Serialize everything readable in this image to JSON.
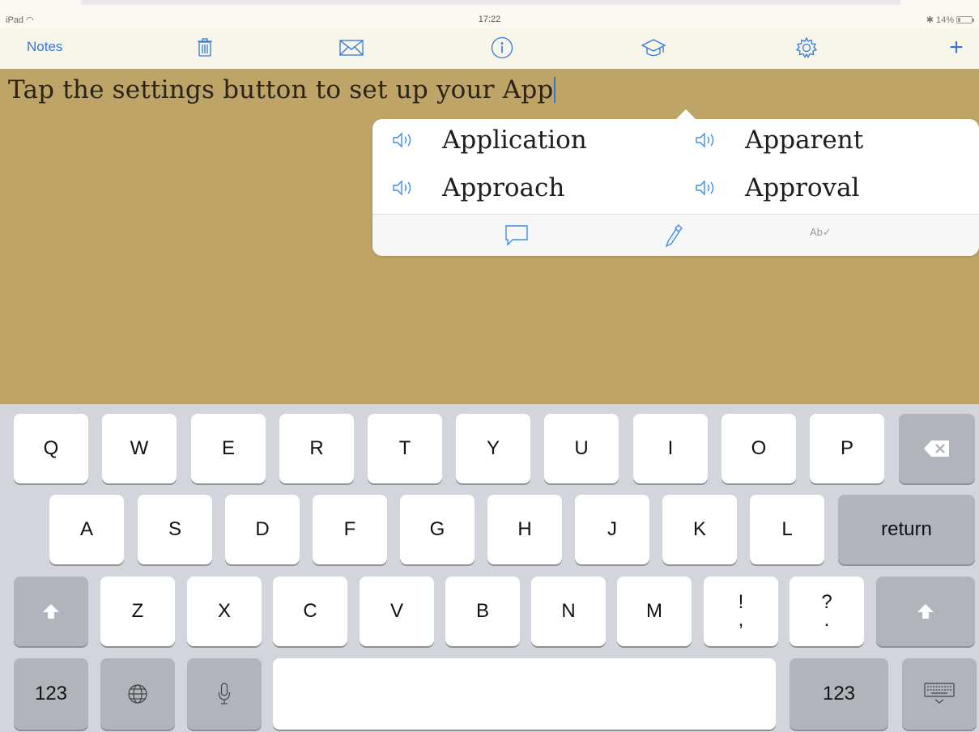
{
  "status_bar": {
    "device": "iPad",
    "time": "17:22",
    "battery": "14%"
  },
  "toolbar": {
    "notes_label": "Notes",
    "plus_label": "+",
    "accent_color": "#2f78d6"
  },
  "editor": {
    "text": "Tap the settings button to set up your App",
    "background": "#bfa467"
  },
  "suggestions": {
    "items": [
      {
        "word": "Application"
      },
      {
        "word": "Apparent"
      },
      {
        "word": "Approach"
      },
      {
        "word": "Approval"
      }
    ],
    "footer_abc_label": "Ab"
  },
  "keyboard": {
    "row1": [
      "Q",
      "W",
      "E",
      "R",
      "T",
      "Y",
      "U",
      "I",
      "O",
      "P"
    ],
    "row2": [
      "A",
      "S",
      "D",
      "F",
      "G",
      "H",
      "J",
      "K",
      "L"
    ],
    "row3": [
      "Z",
      "X",
      "C",
      "V",
      "B",
      "N",
      "M"
    ],
    "punct1_top": "!",
    "punct1_bottom": ",",
    "punct2_top": "?",
    "punct2_bottom": ".",
    "return_label": "return",
    "numbers_label": "123"
  }
}
